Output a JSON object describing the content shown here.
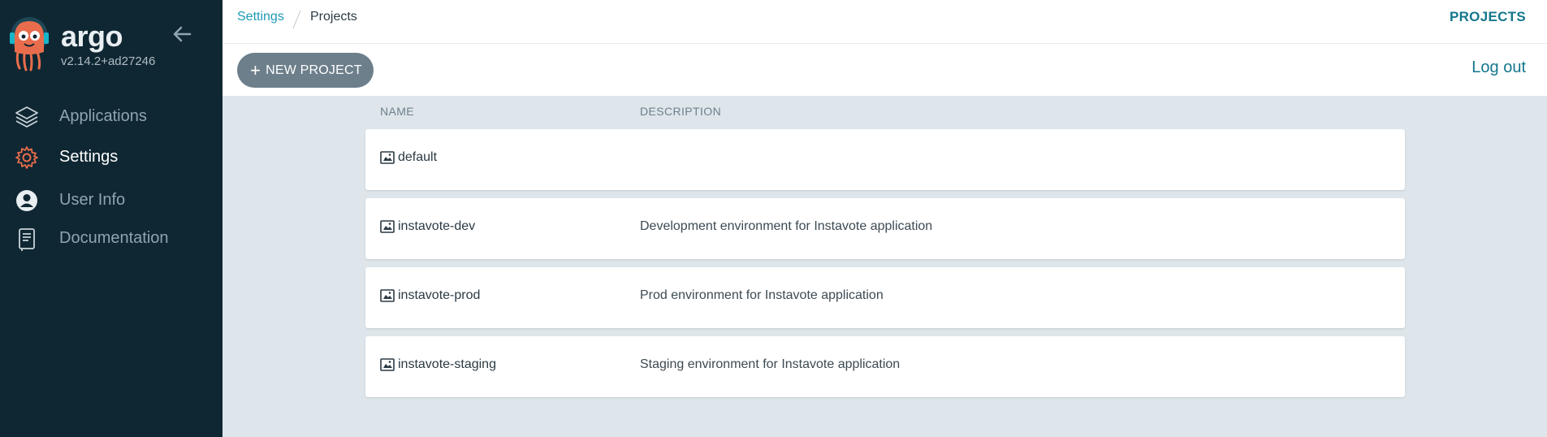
{
  "sidebar": {
    "brand": "argo",
    "version": "v2.14.2+ad27246",
    "items": [
      {
        "label": "Applications",
        "icon": "stack-icon"
      },
      {
        "label": "Settings",
        "icon": "gear-icon"
      },
      {
        "label": "User Info",
        "icon": "user-circle-icon"
      },
      {
        "label": "Documentation",
        "icon": "book-icon"
      }
    ]
  },
  "breadcrumb": {
    "parent": "Settings",
    "current": "Projects"
  },
  "header": {
    "page_label": "PROJECTS"
  },
  "toolbar": {
    "new_project_label": "NEW PROJECT",
    "logout_label": "Log out"
  },
  "table": {
    "columns": [
      "NAME",
      "DESCRIPTION"
    ],
    "rows": [
      {
        "name": "default",
        "description": ""
      },
      {
        "name": "instavote-dev",
        "description": "Development environment for Instavote application"
      },
      {
        "name": "instavote-prod",
        "description": "Prod environment for Instavote application"
      },
      {
        "name": "instavote-staging",
        "description": "Staging environment for Instavote application"
      }
    ]
  },
  "colors": {
    "sidebar_bg": "#0f2733",
    "accent": "#15778d",
    "link": "#1d9bb5",
    "settings_icon": "#e96d4c",
    "button_bg": "#6d7f8b",
    "content_bg": "#dee6eb"
  }
}
